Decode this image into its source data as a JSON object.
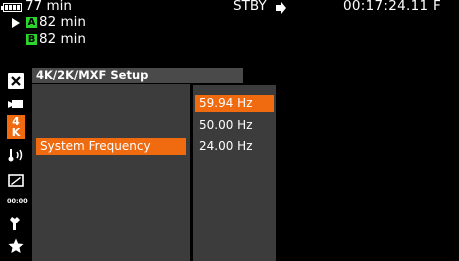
{
  "status": {
    "battery_time": "77 min",
    "slot_a_label": "A",
    "slot_a_time": "82 min",
    "slot_b_label": "B",
    "slot_b_time": "82 min",
    "mode": "STBY",
    "timecode": "00:17:24.11 F"
  },
  "sidebar": {
    "items": [
      {
        "icon": "close-icon",
        "glyph": "✕"
      },
      {
        "icon": "camera-icon",
        "glyph": ""
      },
      {
        "icon": "4k-icon",
        "glyph": "4K"
      },
      {
        "icon": "audio-icon",
        "glyph": "♪"
      },
      {
        "icon": "media-icon",
        "glyph": ""
      },
      {
        "icon": "timecode-icon",
        "glyph": "00:00"
      },
      {
        "icon": "wrench-icon",
        "glyph": ""
      },
      {
        "icon": "star-icon",
        "glyph": "★"
      }
    ]
  },
  "menu": {
    "header": "4K/2K/MXF Setup",
    "selected_item": "System Frequency"
  },
  "submenu": {
    "options": [
      "59.94 Hz",
      "50.00 Hz",
      "24.00 Hz"
    ],
    "selected": "59.94 Hz"
  },
  "colors": {
    "accent": "#f06a0f",
    "slot": "#2bd52b",
    "panel": "#3c3c3c"
  }
}
